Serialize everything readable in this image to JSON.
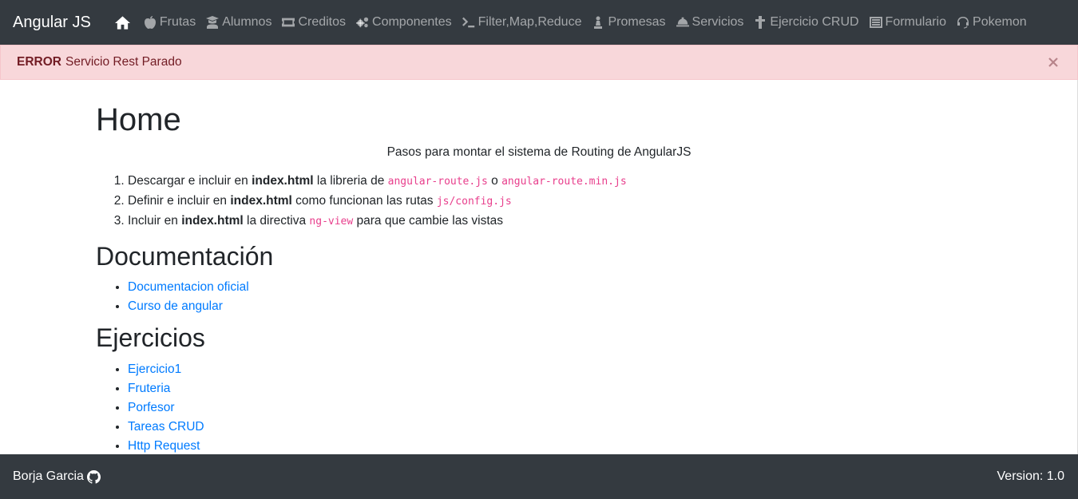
{
  "navbar": {
    "brand": "Angular JS",
    "items": [
      {
        "label": "",
        "icon": "home-icon"
      },
      {
        "label": "Frutas",
        "icon": "apple-icon"
      },
      {
        "label": "Alumnos",
        "icon": "student-icon"
      },
      {
        "label": "Creditos",
        "icon": "ticket-icon"
      },
      {
        "label": "Componentes",
        "icon": "cogs-icon"
      },
      {
        "label": "Filter,Map,Reduce",
        "icon": "console-icon"
      },
      {
        "label": "Promesas",
        "icon": "pawn-icon"
      },
      {
        "label": "Servicios",
        "icon": "bell-icon"
      },
      {
        "label": "Ejercicio CRUD",
        "icon": "cross-icon"
      },
      {
        "label": "Formulario",
        "icon": "list-icon"
      },
      {
        "label": "Pokemon",
        "icon": "headset-icon"
      }
    ]
  },
  "alert": {
    "title": "ERROR",
    "message": "Servicio Rest Parado",
    "close_icon": "close-icon"
  },
  "main": {
    "title": "Home",
    "subtitle": "Pasos para montar el sistema de Routing de AngularJS",
    "steps": [
      {
        "pre": "Descargar e incluir en ",
        "bold": "index.html",
        "mid": " la libreria de ",
        "code1": "angular-route.js",
        "sep": " o ",
        "code2": "angular-route.min.js",
        "post": ""
      },
      {
        "pre": "Definir e incluir en ",
        "bold": "index.html",
        "mid": " como funcionan las rutas ",
        "code1": "js/config.js",
        "sep": "",
        "code2": "",
        "post": ""
      },
      {
        "pre": "Incluir en ",
        "bold": "index.html",
        "mid": " la directiva ",
        "code1": "ng-view",
        "sep": "",
        "code2": "",
        "post": " para que cambie las vistas"
      }
    ],
    "doc_heading": "Documentación",
    "doc_links": [
      "Documentacion oficial",
      "Curso de angular"
    ],
    "ex_heading": "Ejercicios",
    "ex_links": [
      "Ejercicio1",
      "Fruteria",
      "Porfesor",
      "Tareas CRUD",
      "Http Request"
    ]
  },
  "footer": {
    "author": "Borja Garcia",
    "author_icon": "github-icon",
    "version": "Version: 1.0"
  },
  "colors": {
    "navbar_bg": "#343a40",
    "alert_bg": "#f8d7da",
    "alert_text": "#721c24",
    "link": "#007bff",
    "code": "#e83e8c"
  }
}
